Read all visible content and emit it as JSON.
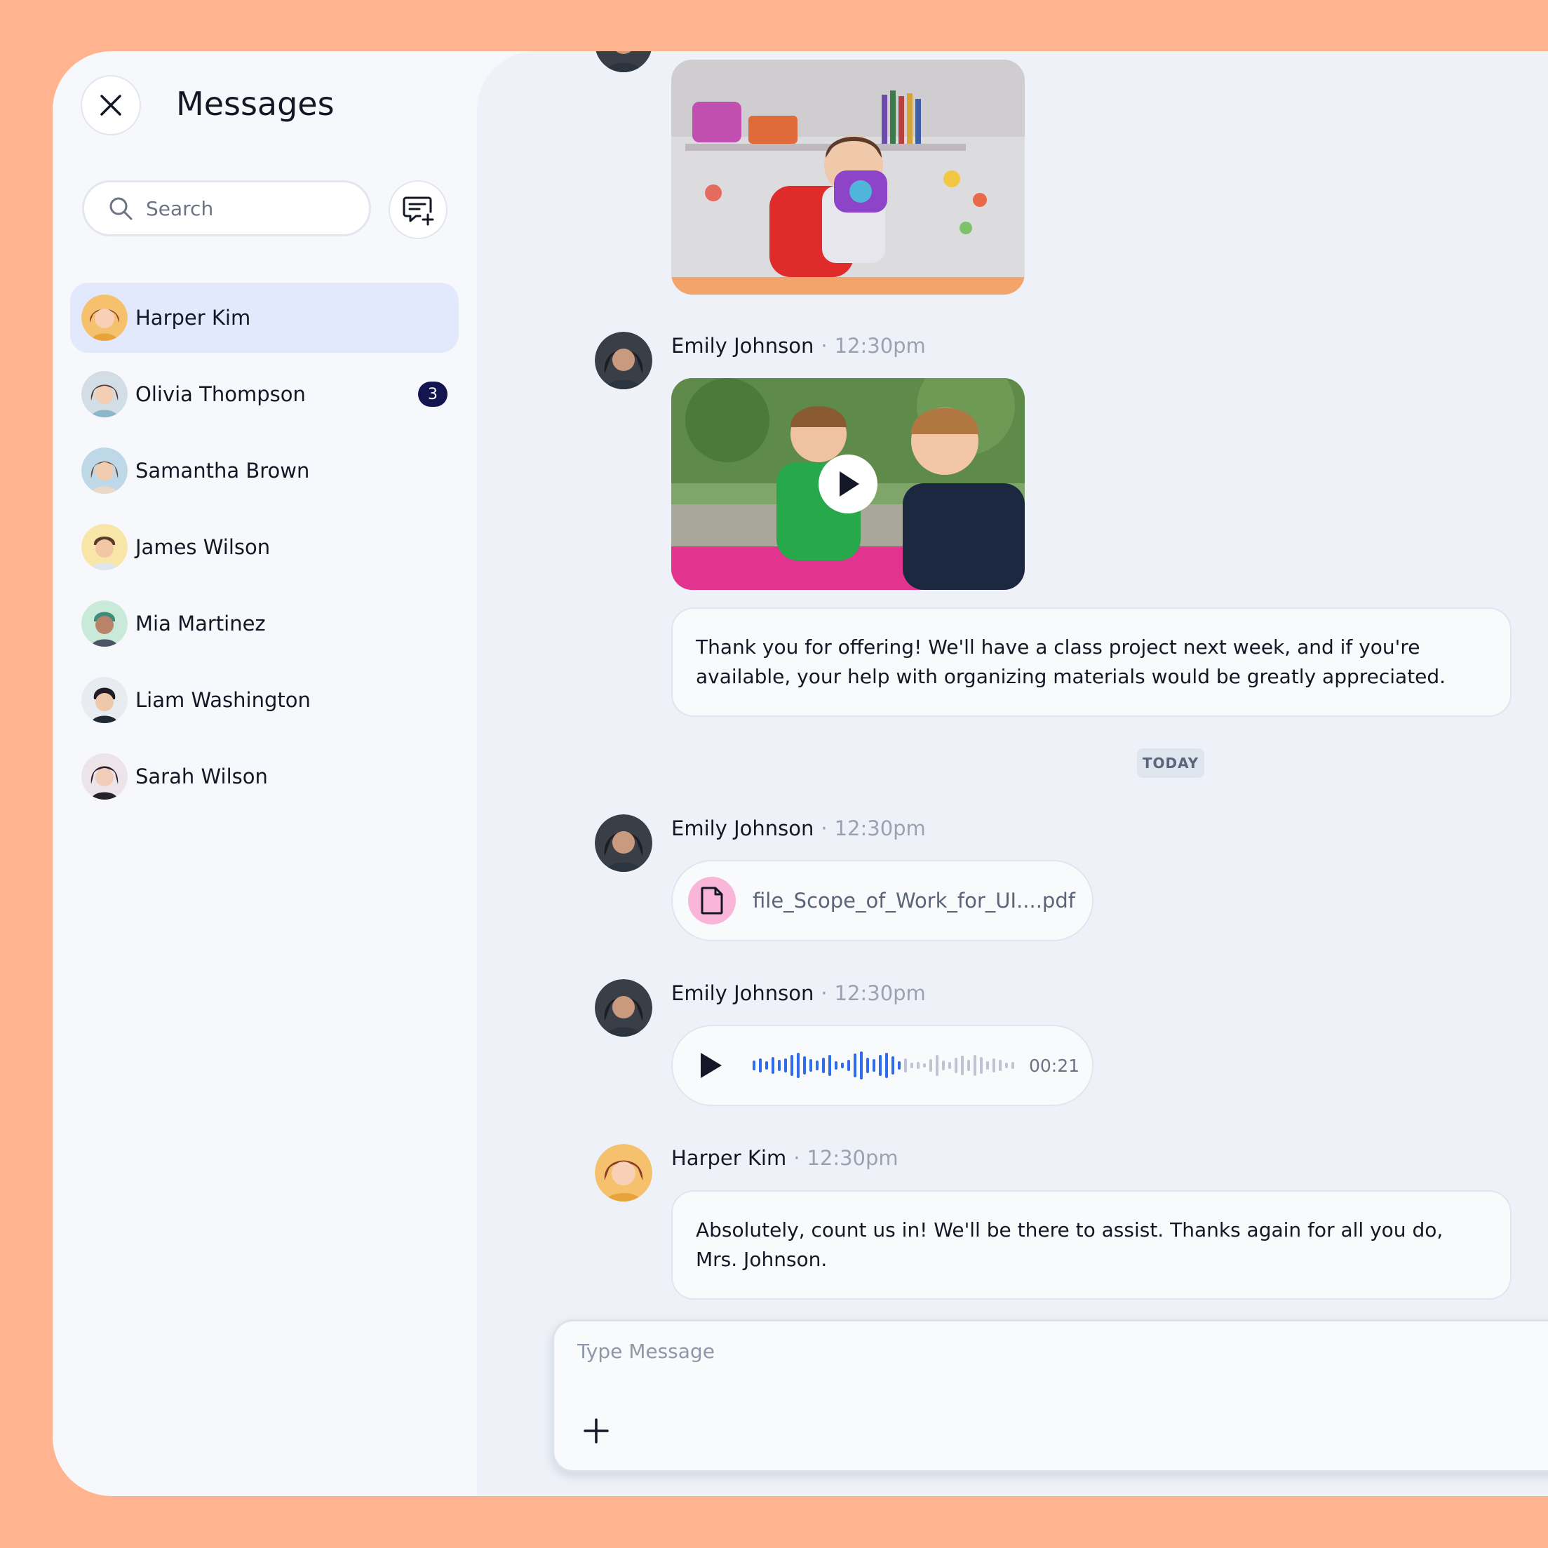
{
  "header": {
    "title": "Messages"
  },
  "search": {
    "placeholder": "Search"
  },
  "contacts": [
    {
      "name": "Harper Kim",
      "active": true,
      "badge": ""
    },
    {
      "name": "Olivia Thompson",
      "active": false,
      "badge": "3"
    },
    {
      "name": "Samantha Brown",
      "active": false,
      "badge": ""
    },
    {
      "name": "James Wilson",
      "active": false,
      "badge": ""
    },
    {
      "name": "Mia Martinez",
      "active": false,
      "badge": ""
    },
    {
      "name": "Liam Washington",
      "active": false,
      "badge": ""
    },
    {
      "name": "Sarah Wilson",
      "active": false,
      "badge": ""
    }
  ],
  "messages": [
    {
      "sender": "Emily Johnson",
      "time": "12:30pm",
      "type": "video"
    },
    {
      "text": "Thank you for offering! We'll have a class project next week, and if you're available, your help with organizing materials would be greatly appreciated."
    },
    {
      "sender": "Emily Johnson",
      "time": "12:30pm",
      "type": "file",
      "file_name": "file_Scope_of_Work_for_UI....pdf"
    },
    {
      "sender": "Emily Johnson",
      "time": "12:30pm",
      "type": "audio",
      "duration": "00:21",
      "progress": 0.56
    },
    {
      "sender": "Harper Kim",
      "time": "12:30pm",
      "type": "text",
      "text": "Absolutely, count us in! We'll be there to assist. Thanks again for all you do, Mrs. Johnson."
    }
  ],
  "divider": {
    "label": "TODAY"
  },
  "composer": {
    "placeholder": "Type Message"
  },
  "colors": {
    "accent": "#2F6BEA",
    "active_contact": "#E3E9FD",
    "badge": "#141450",
    "background": "#FFB48F"
  },
  "icons": [
    "close-icon",
    "search-icon",
    "new-message-icon",
    "play-icon",
    "file-icon",
    "plus-icon"
  ]
}
